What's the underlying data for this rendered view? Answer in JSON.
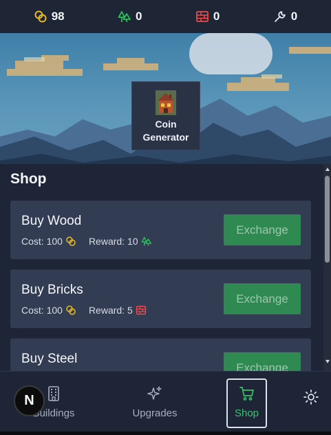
{
  "resources": [
    {
      "name": "coins",
      "icon": "coin-icon",
      "value": "98",
      "color": "#e8b91f"
    },
    {
      "name": "wood",
      "icon": "tree-icon",
      "value": "0",
      "color": "#27c15a"
    },
    {
      "name": "bricks",
      "icon": "brick-icon",
      "value": "0",
      "color": "#ef4a4a"
    },
    {
      "name": "steel",
      "icon": "wrench-icon",
      "value": "0",
      "color": "#e6e9ef"
    }
  ],
  "scene": {
    "generator": {
      "label_line1": "Coin",
      "label_line2": "Generator"
    }
  },
  "shop": {
    "title": "Shop",
    "items": [
      {
        "title": "Buy Wood",
        "cost_label": "Cost: 100",
        "reward_label": "Reward: 10",
        "reward_icon": "tree-icon",
        "button": "Exchange"
      },
      {
        "title": "Buy Bricks",
        "cost_label": "Cost: 100",
        "reward_label": "Reward: 5",
        "reward_icon": "brick-icon",
        "button": "Exchange"
      },
      {
        "title": "Buy Steel",
        "button": "Exchange"
      }
    ]
  },
  "nav": {
    "items": [
      {
        "label": "Buildings",
        "icon": "building-icon"
      },
      {
        "label": "Upgrades",
        "icon": "sparkles-icon"
      },
      {
        "label": "Shop",
        "icon": "cart-icon",
        "active": true
      }
    ],
    "theme_icon": "sun-icon",
    "badge": "N"
  },
  "colors": {
    "accent": "#3bc46e",
    "button_bg": "#2f8a52",
    "card_bg": "#323c52",
    "panel_bg": "#1d2536"
  }
}
